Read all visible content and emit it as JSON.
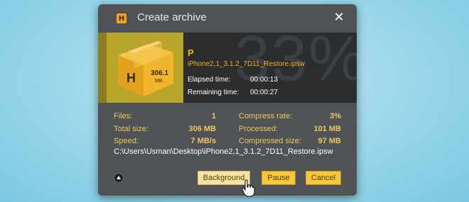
{
  "dialog": {
    "app_icon_letter": "H",
    "title": "Create archive",
    "close_glyph": "✕"
  },
  "banner": {
    "percent": "33%",
    "status_letter": "P",
    "current_file": "iPhone2,1_3.1.2_7D11_Restore.ipsw",
    "elapsed_label": "Elapsed time:",
    "elapsed_value": "00:00:13",
    "remaining_label": "Remaining time:",
    "remaining_value": "00:00:27",
    "box_label_value": "306.1",
    "box_label_unit": "MB",
    "box_letter": "H"
  },
  "stats": {
    "files_label": "Files:",
    "files_value": "1",
    "total_size_label": "Total size:",
    "total_size_value": "306 MB",
    "speed_label": "Speed:",
    "speed_value": "7 MB/s",
    "compress_rate_label": "Compress rate:",
    "compress_rate_value": "3%",
    "processed_label": "Processed:",
    "processed_value": "101 MB",
    "compressed_size_label": "Compressed size:",
    "compressed_size_value": "97 MB"
  },
  "path": "C:\\Users\\Usman\\Desktop\\iPhone2,1_3.1.2_7D11_Restore.ipsw",
  "buttons": {
    "background": "Background",
    "pause": "Pause",
    "cancel": "Cancel"
  },
  "colors": {
    "accent": "#f2b01e",
    "button": "#f4c73e",
    "dialog_bg": "#4f5355"
  }
}
